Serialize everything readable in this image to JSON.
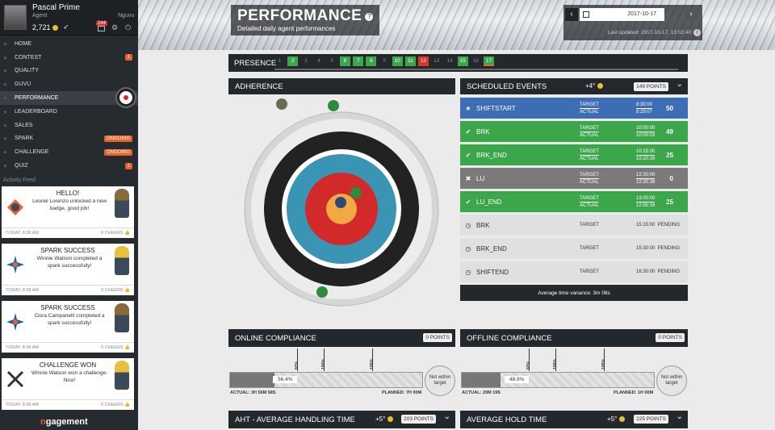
{
  "profile": {
    "name": "Pascal Prime",
    "role": "Agent",
    "team": "Nguvu",
    "score": "2,721",
    "notif_count": "244"
  },
  "nav": [
    {
      "label": "Home",
      "icon": "house-icon",
      "badge": ""
    },
    {
      "label": "Contest",
      "icon": "trophy-icon",
      "badge": "1"
    },
    {
      "label": "Quality",
      "icon": "heart-icon",
      "badge": ""
    },
    {
      "label": "Guvu",
      "icon": "people-icon",
      "badge": ""
    },
    {
      "label": "Performance",
      "icon": "target-icon",
      "badge": ""
    },
    {
      "label": "Leaderboard",
      "icon": "list-icon",
      "badge": ""
    },
    {
      "label": "Sales",
      "icon": "dollar-icon",
      "badge": ""
    },
    {
      "label": "Spark",
      "icon": "spark-icon",
      "badge": "ONGOING"
    },
    {
      "label": "Challenge",
      "icon": "swords-icon",
      "badge": "ONGOING"
    },
    {
      "label": "Quiz",
      "icon": "pencil-icon",
      "badge": "1"
    }
  ],
  "activity": {
    "title": "Activity Feed",
    "cards": [
      {
        "title": "Hello!",
        "text": "Leonel Lorenzo unlocked a new badge, good job!",
        "time": "TODAY, 8:38 AM",
        "cheers": "0 CHEERS",
        "icon": "badge-icon"
      },
      {
        "title": "Spark Success",
        "text": "Winnie Watson completed a spark successfully!",
        "time": "TODAY, 8:08 AM",
        "cheers": "0 CHEERS",
        "icon": "spark-icon"
      },
      {
        "title": "Spark Success",
        "text": "Clora Campanelli completed a spark successfully!",
        "time": "TODAY, 8:08 AM",
        "cheers": "0 CHEERS",
        "icon": "spark-icon"
      },
      {
        "title": "Challenge Won",
        "text": "Winnie Watson won a challenge. Nice!",
        "time": "TODAY, 8:08 AM",
        "cheers": "0 CHEERS",
        "icon": "swords-icon"
      }
    ]
  },
  "logo": {
    "prefix": "n",
    "rest": "gagement"
  },
  "header": {
    "title": "PERFORMANCE",
    "subtitle": "Detailed daily agent performances",
    "date": "2017-10-17",
    "last_updated": "Last updated: 2017-10-17, 13:02:40"
  },
  "presence": {
    "label": "PRESENCE",
    "days": [
      {
        "n": "1",
        "s": ""
      },
      {
        "n": "2",
        "s": "g"
      },
      {
        "n": "3",
        "s": ""
      },
      {
        "n": "4",
        "s": ""
      },
      {
        "n": "5",
        "s": ""
      },
      {
        "n": "6",
        "s": "g"
      },
      {
        "n": "7",
        "s": "g"
      },
      {
        "n": "8",
        "s": "g"
      },
      {
        "n": "9",
        "s": ""
      },
      {
        "n": "10",
        "s": "g"
      },
      {
        "n": "11",
        "s": "g"
      },
      {
        "n": "12",
        "s": "r"
      },
      {
        "n": "13",
        "s": ""
      },
      {
        "n": "14",
        "s": ""
      },
      {
        "n": "15",
        "s": "g"
      },
      {
        "n": "16",
        "s": ""
      },
      {
        "n": "17",
        "s": "o"
      }
    ]
  },
  "adherence": {
    "label": "ADHERENCE"
  },
  "scheduled": {
    "label": "SCHEDULED EVENTS",
    "bonus": "+4°",
    "points": "149 POINTS",
    "avg_variance": "Average time variance: 3m 08s",
    "events": [
      {
        "name": "SHIFTSTART",
        "color": "blue",
        "target": "8:30:00",
        "actual": "8:29:07",
        "score": "50",
        "icon": "star-icon",
        "target_lbl": "Target",
        "actual_lbl": "Actual"
      },
      {
        "name": "BRK",
        "color": "green",
        "target": "10:00:00",
        "actual": "10:00:03",
        "score": "49",
        "icon": "check-icon",
        "target_lbl": "Target",
        "actual_lbl": "Actual"
      },
      {
        "name": "BRK_END",
        "color": "green",
        "target": "10:15:00",
        "actual": "10:10:16",
        "score": "25",
        "icon": "check-icon",
        "target_lbl": "Target",
        "actual_lbl": "Actual"
      },
      {
        "name": "LU",
        "color": "gray",
        "target": "12:30:00",
        "actual": "12:35:38",
        "score": "0",
        "icon": "x-icon",
        "target_lbl": "Target",
        "actual_lbl": "Actual"
      },
      {
        "name": "LU_END",
        "color": "green",
        "target": "13:00:00",
        "actual": "12:55:16",
        "score": "25",
        "icon": "check-icon",
        "target_lbl": "Target",
        "actual_lbl": "Actual"
      },
      {
        "name": "BRK",
        "color": "light",
        "target": "15:15:00",
        "actual": "",
        "score": "Pending",
        "icon": "clock-icon",
        "target_lbl": "Target",
        "actual_lbl": ""
      },
      {
        "name": "BRK_END",
        "color": "light",
        "target": "15:30:00",
        "actual": "",
        "score": "Pending",
        "icon": "clock-icon",
        "target_lbl": "Target",
        "actual_lbl": ""
      },
      {
        "name": "SHIFTEND",
        "color": "light",
        "target": "16:30:00",
        "actual": "",
        "score": "Pending",
        "icon": "clock-icon",
        "target_lbl": "Target",
        "actual_lbl": ""
      }
    ]
  },
  "online": {
    "label": "ONLINE COMPLIANCE",
    "points": "0 POINTS",
    "value": "56.4%",
    "fraction": 0.23,
    "ticks": [
      "97%",
      "100%",
      "105%"
    ],
    "circle": "Not within target",
    "actual": "ACTUAL: 3h 56m 58s",
    "planned": "PLANNED: 7h 00m"
  },
  "offline": {
    "label": "OFFLINE COMPLIANCE",
    "points": "0 POINTS",
    "value": "48.9%",
    "fraction": 0.2,
    "ticks": [
      "97%",
      "100%",
      "105%"
    ],
    "circle": "Not within target",
    "actual": "ACTUAL: 29m 19s",
    "planned": "PLANNED: 1h 00m"
  },
  "aht": {
    "label": "AHT - AVERAGE HANDLING TIME",
    "bonus": "+5°",
    "points": "203 POINTS"
  },
  "aht2": {
    "label": "AVERAGE HOLD TIME",
    "bonus": "+5°",
    "points": "225 POINTS"
  }
}
